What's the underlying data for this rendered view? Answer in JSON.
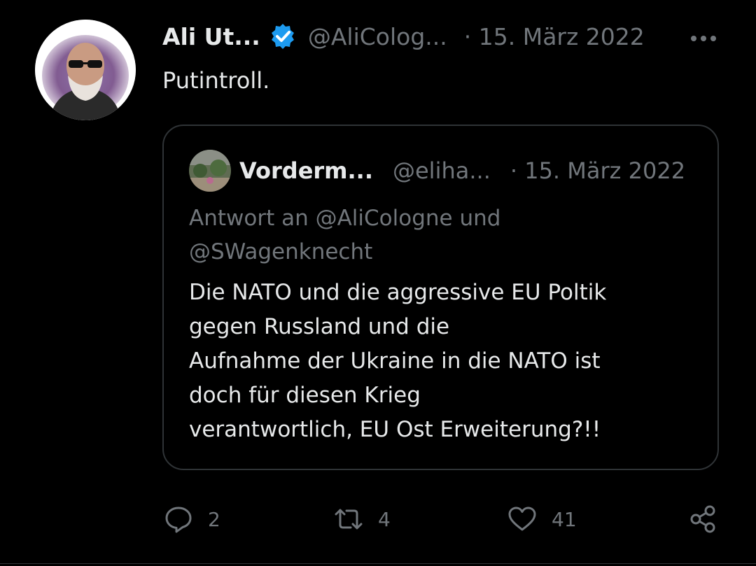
{
  "tweet": {
    "author_name": "Ali Ut...",
    "handle": "@AliColog...",
    "date": "· 15. März 2022",
    "text": "Putintroll."
  },
  "quoted_tweet": {
    "author_name": "Vorderm...",
    "handle": "@eliha...",
    "date": "· 15. März 2022",
    "reply_context": [
      "Antwort an @AliCologne und",
      "@SWagenknecht"
    ],
    "body_lines": [
      "Die NATO und die aggressive EU Poltik",
      "gegen Russland und die",
      "Aufnahme der Ukraine in die NATO ist",
      "doch für diesen Krieg",
      "verantwortlich, EU Ost Erweiterung?!!"
    ]
  },
  "actions": {
    "reply_count": "2",
    "retweet_count": "4",
    "like_count": "41"
  },
  "icons": {
    "more": "more-horizontal-icon",
    "verified": "verified-badge-icon",
    "reply": "reply-icon",
    "retweet": "retweet-icon",
    "like": "heart-icon",
    "share": "share-icon"
  },
  "colors": {
    "background": "#000000",
    "primary_text": "#e7e9ea",
    "secondary_text": "#71767b",
    "border": "#2f3336",
    "verified_blue": "#1d9bf0"
  }
}
